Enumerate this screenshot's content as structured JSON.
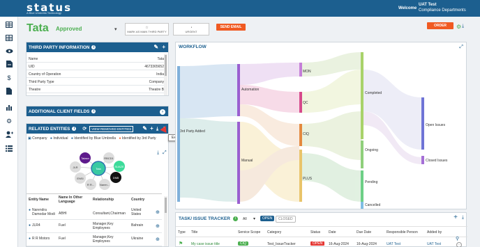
{
  "app": {
    "logo": "status",
    "logo_tagline": "A Blue Umbrella Technology",
    "welcome": "Welcome",
    "user_name": "UAT Test",
    "user_dept": "Compliance Departments"
  },
  "nav": [
    "table-icon",
    "table-icon",
    "eye-icon",
    "document-edit-icon",
    "dollar-icon",
    "document-icon",
    "chart-icon",
    "gear-icon",
    "user-add-icon",
    "list-icon"
  ],
  "header": {
    "entity_name": "Tata",
    "status": "Approved",
    "mark_as_main": "MARK AS MAIN THIRD PARTY",
    "urgent": "URGENT",
    "send_email": "SEND EMAIL",
    "order": "ORDER"
  },
  "tpi": {
    "title": "THIRD PARTY INFORMATION",
    "rows": [
      {
        "k": "Name",
        "v": "Tata"
      },
      {
        "k": "UID",
        "v": "4673365652"
      },
      {
        "k": "Country of Operation",
        "v": "India"
      },
      {
        "k": "Third Party Type",
        "v": "Company"
      },
      {
        "k": "Theatre",
        "v": "Theatre B"
      }
    ]
  },
  "acf": {
    "title": "ADDITIONAL CLIENT FIELDS"
  },
  "related": {
    "title": "RELATED ENTITIES",
    "view_removed": "VIEW REMOVED ENTITIES",
    "tooltip": "Expand",
    "filters": [
      "Company",
      "Individual",
      "Identified by Blue Umbrella",
      "Identified by 3rd Party"
    ],
    "nodes": [
      "Tata",
      "Tatasn",
      "RBCD1",
      "SUAZE",
      "JLR",
      "ENSI",
      "R R...",
      "Naren...",
      "DNB"
    ],
    "columns": [
      "Entity Name",
      "Name In Other Language",
      "Relationship",
      "Country"
    ],
    "rows": [
      {
        "name": "Narendra Damodar Modi",
        "other": "ABHI",
        "rel": "Consultant,Chairman",
        "country": "United States"
      },
      {
        "name": "JLR4",
        "other": "Fuel",
        "rel": "Manager,Key Employees",
        "country": "Bahrain"
      },
      {
        "name": "R R Motors",
        "other": "Fuel",
        "rel": "Manager,Key Employees",
        "country": "Ukraine"
      }
    ]
  },
  "workflow": {
    "title": "WORKFLOW",
    "labels": [
      "3rd Party Added",
      "Automation",
      "Manual",
      "MON",
      "QC",
      "CIQ",
      "PLUS",
      "Completed",
      "Ongoing",
      "Pending",
      "Cancelled",
      "Open Issues",
      "Closed Issues"
    ]
  },
  "tasks": {
    "title": "TASK/ ISSUE TRACKER",
    "filter_value": "All",
    "open": "OPEN",
    "closed": "CLOSED",
    "columns": [
      "Type",
      "Title",
      "Service Scope",
      "Category",
      "Status",
      "Date",
      "Due Date",
      "Responsible Person",
      "Added by"
    ],
    "row": {
      "title": "My case issue title",
      "scope": "CIQ",
      "category": "Test_IssueTracker",
      "status": "OPEN",
      "date": "16-Aug-2024",
      "due": "16-Aug-2024",
      "person": "UAT Test",
      "added_by": "UAT Test"
    }
  }
}
